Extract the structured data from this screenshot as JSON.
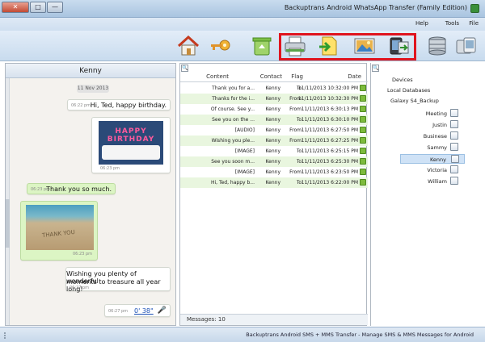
{
  "window": {
    "title": "Backuptrans Android WhatsApp Transfer (Family Edition)",
    "btn_close": "✕",
    "btn_max": "□",
    "btn_min": "—"
  },
  "menu": {
    "file": "File",
    "tools": "Tools",
    "help": "Help"
  },
  "toolbar": {
    "icons": [
      "devices-icon",
      "database-icon",
      "export-image-icon",
      "transfer-icon",
      "print-icon",
      "recycle-icon",
      "key-icon",
      "home-icon"
    ]
  },
  "chat": {
    "contact": "Kenny",
    "date": "11 Nov 2013",
    "messages": [
      {
        "text": "Hi, Ted, happy birthday.",
        "time": "06:22 pm"
      },
      {
        "image": "birthday-cake",
        "caption_time": "06:23 pm"
      },
      {
        "text": "Thank you so much.",
        "time": "06:23 pm"
      },
      {
        "image": "beach-sand",
        "caption_time": "06:23 pm"
      },
      {
        "text_line1": "Wishing you plenty of wonderful",
        "text_line2": "moments to treasure all year long!",
        "time": "06:27 pm"
      },
      {
        "audio": "0' 38\"",
        "time": "06:27 pm"
      }
    ],
    "cake_text": "HAPPY BIRTHDAY",
    "sand_text": "THANK YOU"
  },
  "table": {
    "columns": {
      "date": "Date",
      "flag": "Flag",
      "contact": "Contact",
      "content": "Content"
    },
    "rows": [
      {
        "date": "11/11/2013 10:32:00 PM",
        "flag": "To",
        "contact": "Kenny",
        "content": "Thank you for a..."
      },
      {
        "date": "11/11/2013 10:32:30 PM",
        "flag": "From",
        "contact": "Kenny",
        "content": "Thanks for the i..."
      },
      {
        "date": "11/11/2013 6:30:13 PM",
        "flag": "From",
        "contact": "Kenny",
        "content": "Of course. See y..."
      },
      {
        "date": "11/11/2013 6:30:10 PM",
        "flag": "To",
        "contact": "Kenny",
        "content": "See you on the ..."
      },
      {
        "date": "11/11/2013 6:27:50 PM",
        "flag": "From",
        "contact": "Kenny",
        "content": "[AUDIO]"
      },
      {
        "date": "11/11/2013 6:27:25 PM",
        "flag": "From",
        "contact": "Kenny",
        "content": "Wishing you ple..."
      },
      {
        "date": "11/11/2013 6:25:15 PM",
        "flag": "To",
        "contact": "Kenny",
        "content": "[IMAGE]"
      },
      {
        "date": "11/11/2013 6:25:30 PM",
        "flag": "To",
        "contact": "Kenny",
        "content": "See you soon m..."
      },
      {
        "date": "11/11/2013 6:23:50 PM",
        "flag": "From",
        "contact": "Kenny",
        "content": "[IMAGE]"
      },
      {
        "date": "11/11/2013 6:22:00 PM",
        "flag": "To",
        "contact": "Kenny",
        "content": "Hi, Ted, happy b..."
      }
    ],
    "count": "Messages: 10"
  },
  "tree": {
    "devices": "Devices",
    "local_db": "Local Databases",
    "backup": "Galaxy S4_Backup",
    "contacts": [
      "Meeting",
      "Justin",
      "Businese",
      "Sammy",
      "Kenny",
      "Victoria",
      "William"
    ],
    "selected": "Kenny"
  },
  "status": {
    "text": "Backuptrans Android SMS + MMS Transfer - Manage SMS & MMS Messages for Android"
  },
  "colors": {
    "highlight": "#e0141e",
    "bubble_green": "#dcf5c4",
    "row_alt": "#e9f6df"
  }
}
